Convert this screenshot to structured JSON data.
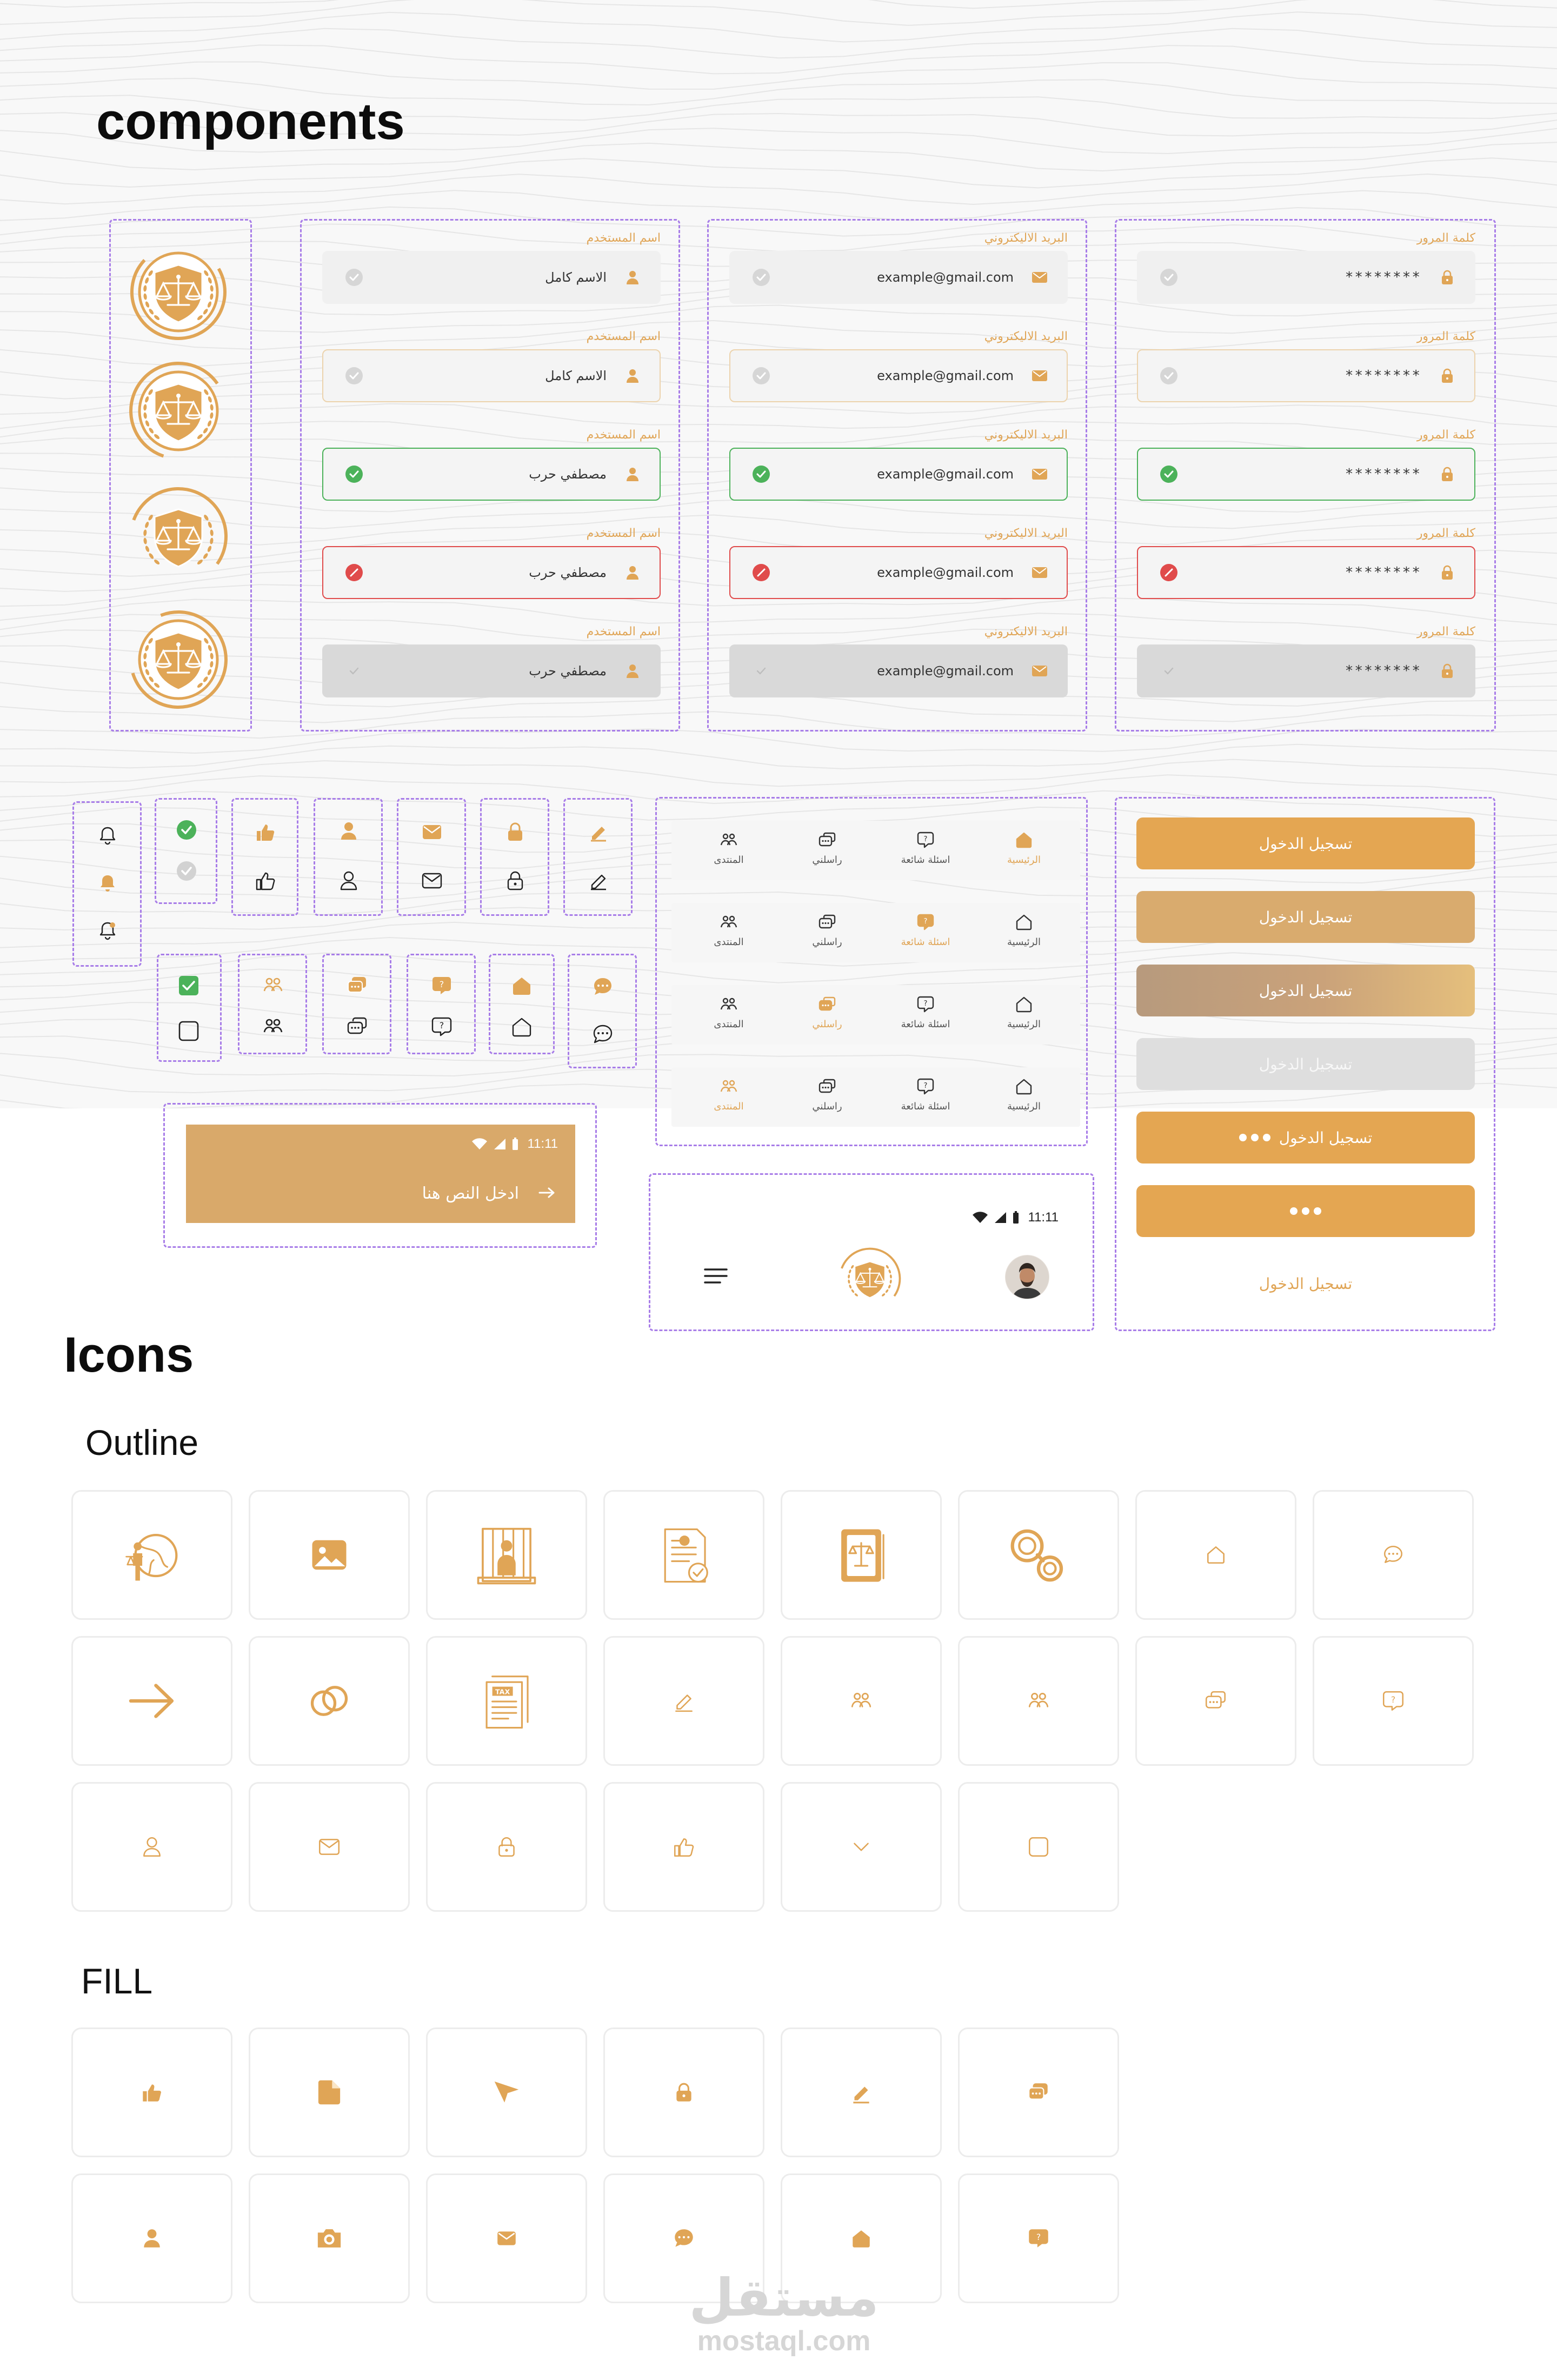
{
  "headings": {
    "components": "components",
    "icons": "Icons",
    "outline": "Outline",
    "fill": "FILL"
  },
  "colors": {
    "accent": "#E0A556",
    "accent_light": "#D4A86A",
    "success": "#4CB25A",
    "error": "#E04B4B",
    "dash": "#A87DE8"
  },
  "username_field": {
    "label": "اسم المستخدم",
    "placeholder_value": "الاسم كامل",
    "filled_value": "مصطفي حرب"
  },
  "email_field": {
    "label": "البريد الاليكتروني",
    "value": "example@gmail.com"
  },
  "password_field": {
    "label": "كلمة المرور",
    "value": "********"
  },
  "field_states": [
    "default",
    "focused",
    "success",
    "error",
    "disabled"
  ],
  "nav": {
    "items": [
      "الرئيسية",
      "اسئلة شائعة",
      "راسلني",
      "المنتدى"
    ],
    "active_rows": [
      0,
      1,
      2,
      3
    ]
  },
  "status_bar": {
    "time": "11:11"
  },
  "input_bar": {
    "placeholder": "ادخل النص هنا"
  },
  "buttons": {
    "login": "تسجيل الدخول"
  },
  "outline_icons": [
    "justice-figure-icon",
    "image-icon",
    "prison-icon",
    "document-icon",
    "law-book-icon",
    "handcuffs-icon",
    "home-icon",
    "chat-icon",
    "arrow-right-icon",
    "link-icon",
    "tax-document-icon",
    "pen-icon",
    "forum-icon",
    "forum-icon-alt",
    "messages-icon",
    "faq-icon",
    "user-icon",
    "mail-icon",
    "lock-icon",
    "like-icon",
    "chevron-down-icon",
    "checkbox-icon"
  ],
  "fill_icons": [
    "like-icon",
    "file-icon",
    "send-icon",
    "lock-icon",
    "pen-icon",
    "messages-icon",
    "user-icon",
    "camera-icon",
    "mail-icon",
    "chat-icon",
    "home-icon",
    "faq-icon"
  ],
  "watermark": {
    "arabic": "مستقل",
    "latin": "mostaql.com"
  }
}
